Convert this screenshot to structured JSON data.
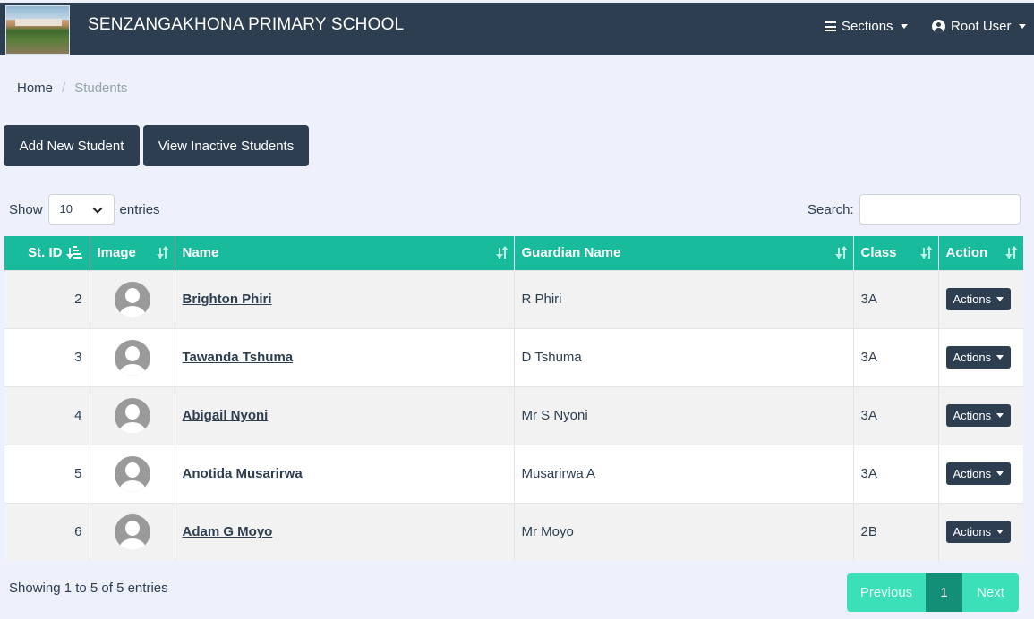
{
  "navbar": {
    "brand": "SENZANGAKHONA PRIMARY SCHOOL",
    "sections_label": "Sections",
    "user_label": "Root User"
  },
  "breadcrumb": {
    "home": "Home",
    "separator": "/",
    "current": "Students"
  },
  "buttons": {
    "add_student": "Add New Student",
    "view_inactive": "View Inactive Students"
  },
  "length_control": {
    "show_label": "Show",
    "selected": "10",
    "entries_label": "entries"
  },
  "search": {
    "label": "Search:",
    "value": ""
  },
  "table": {
    "columns": [
      "St. ID",
      "Image",
      "Name",
      "Guardian Name",
      "Class",
      "Action"
    ],
    "rows": [
      {
        "id": "2",
        "name": "Brighton Phiri",
        "guardian": "R Phiri",
        "class": "3A",
        "action": "Actions"
      },
      {
        "id": "3",
        "name": "Tawanda Tshuma",
        "guardian": "D Tshuma",
        "class": "3A",
        "action": "Actions"
      },
      {
        "id": "4",
        "name": "Abigail Nyoni",
        "guardian": "Mr S Nyoni",
        "class": "3A",
        "action": "Actions"
      },
      {
        "id": "5",
        "name": "Anotida Musarirwa",
        "guardian": "Musarirwa A",
        "class": "3A",
        "action": "Actions"
      },
      {
        "id": "6",
        "name": "Adam G Moyo",
        "guardian": "Mr Moyo",
        "class": "2B",
        "action": "Actions"
      }
    ]
  },
  "footer": {
    "info": "Showing 1 to 5 of 5 entries",
    "previous": "Previous",
    "current_page": "1",
    "next": "Next"
  },
  "colors": {
    "navbar": "#2c3e50",
    "table_header": "#18bc9c",
    "page_background": "#eef0fc"
  }
}
